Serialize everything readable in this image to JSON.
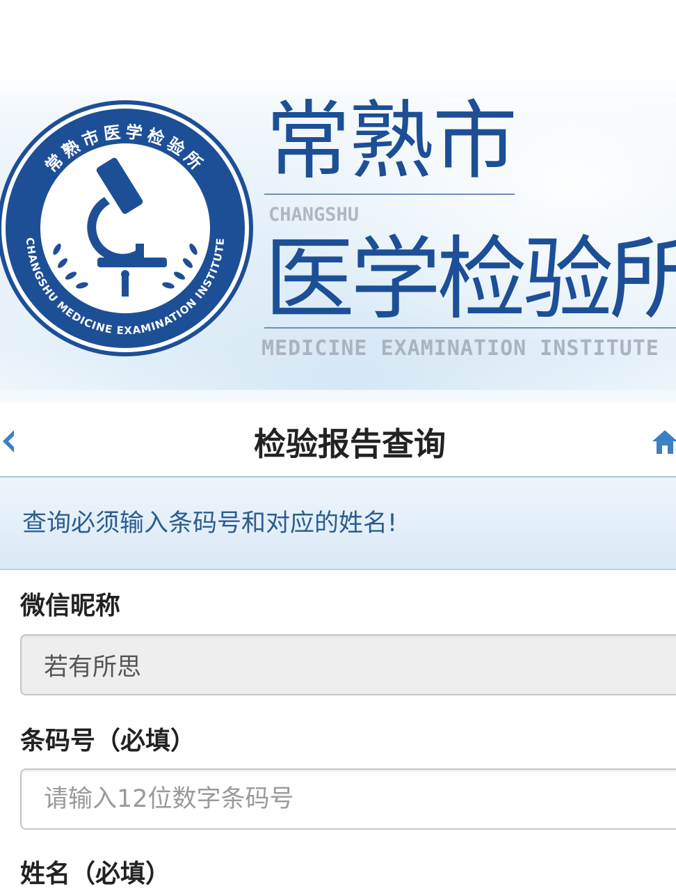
{
  "banner": {
    "title_cn_line1": "常熟市",
    "title_en_line1": "CHANGSHU",
    "title_cn_line2": "医学检验所",
    "title_en_line2": "MEDICINE EXAMINATION INSTITUTE",
    "logo_ring_text_cn": "常熟市医学检验所",
    "logo_ring_text_en": "CHANGSHU MEDICINE EXAMINATION INSTITUTE",
    "brand_color": "#1d4f96"
  },
  "header": {
    "title": "检验报告查询",
    "back_icon": "chevron-left-icon",
    "home_icon": "home-icon",
    "icon_color": "#3b7fc4"
  },
  "notice": {
    "text": "查询必须输入条码号和对应的姓名!"
  },
  "form": {
    "nickname_label": "微信昵称",
    "nickname_value": "若有所思",
    "barcode_label": "条码号（必填）",
    "barcode_placeholder": "请输入12位数字条码号",
    "name_label": "姓名（必填）"
  }
}
